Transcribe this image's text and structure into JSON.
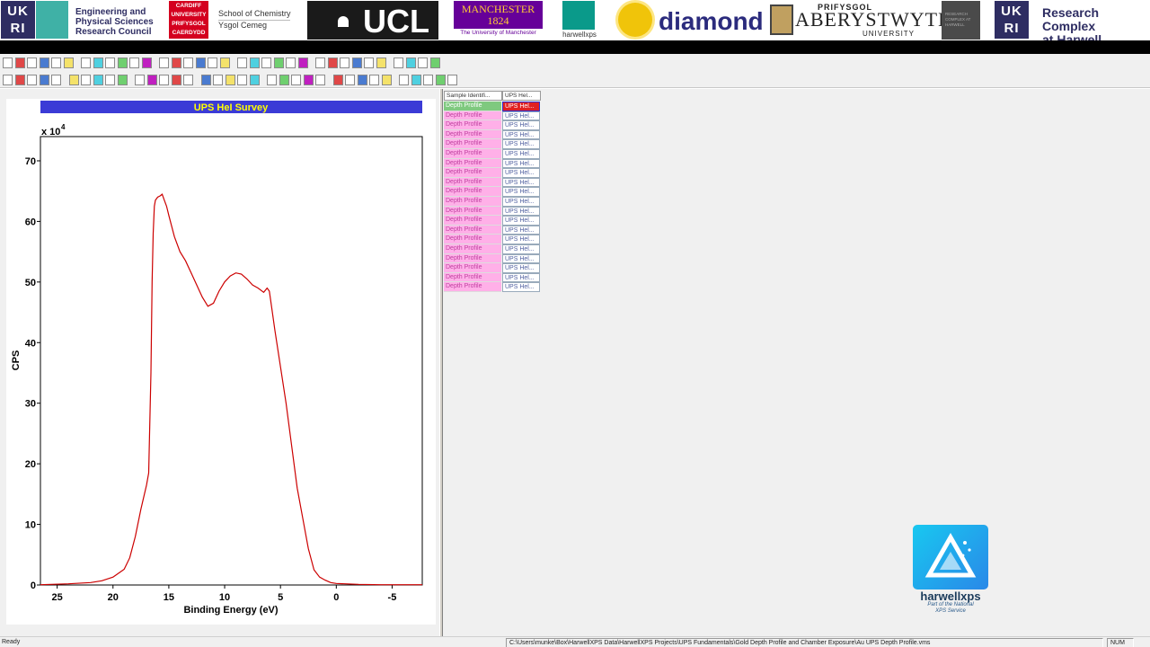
{
  "banner": {
    "ukri_text": "UK\nRI",
    "epsrc_text": "Engineering and\nPhysical Sciences\nResearch Council",
    "cardiff_logo_text": "CARDIFF\nUNIVERSITY\nPRIFYSGOL\nCAERDYDD",
    "cardiff_text": "School of Chemistry\nYsgol Cemeg",
    "ucl_text": "UCL",
    "manchester_text": "MANCHESTER\n1824",
    "manchester_sub": "The University of Manchester",
    "harwellxps_label": "harwellxps",
    "diamond_text": "diamond",
    "aber_top": "PRIFYSGOL",
    "aber_main": "ABERYSTWYTH",
    "aber_bottom": "UNIVERSITY",
    "rch_box_text": "RESEARCH COMPLEX AT HARWELL",
    "rch_text": "Research Complex\nat Harwell"
  },
  "chart_data": {
    "type": "line",
    "title": "UPS HeI Survey",
    "xlabel": "Binding Energy (eV)",
    "ylabel": "CPS",
    "y_multiplier_label": "x 10",
    "y_multiplier_exp": "4",
    "xlim": [
      26.5,
      -7.7
    ],
    "ylim": [
      0,
      74
    ],
    "x_ticks": [
      25,
      20,
      15,
      10,
      5,
      0,
      -5
    ],
    "y_ticks": [
      0,
      10,
      20,
      30,
      40,
      50,
      60,
      70
    ],
    "x_tick_labels": [
      "25",
      "20",
      "15",
      "10",
      "5",
      "0",
      "-5"
    ],
    "y_tick_labels": [
      "0",
      "10",
      "20",
      "30",
      "40",
      "50",
      "60",
      "70"
    ],
    "line_color": "#cc0000",
    "grid": false,
    "series": [
      {
        "points": [
          [
            26.5,
            0.05
          ],
          [
            24,
            0.2
          ],
          [
            22,
            0.4
          ],
          [
            21,
            0.7
          ],
          [
            20,
            1.3
          ],
          [
            19,
            2.6
          ],
          [
            18.5,
            4.5
          ],
          [
            18,
            8
          ],
          [
            17.5,
            12.5
          ],
          [
            17,
            16.5
          ],
          [
            16.8,
            18.5
          ],
          [
            16.6,
            35
          ],
          [
            16.5,
            50
          ],
          [
            16.4,
            58
          ],
          [
            16.3,
            62.5
          ],
          [
            16.2,
            63.5
          ],
          [
            16,
            64
          ],
          [
            15.8,
            64.2
          ],
          [
            15.6,
            64.5
          ],
          [
            15.4,
            63.5
          ],
          [
            15.2,
            62.5
          ],
          [
            15,
            61
          ],
          [
            14.5,
            57.5
          ],
          [
            14,
            55
          ],
          [
            13.5,
            53.5
          ],
          [
            13,
            51.5
          ],
          [
            12.5,
            49.5
          ],
          [
            12,
            47.5
          ],
          [
            11.5,
            46
          ],
          [
            11,
            46.5
          ],
          [
            10.5,
            48.5
          ],
          [
            10,
            50
          ],
          [
            9.5,
            51
          ],
          [
            9,
            51.5
          ],
          [
            8.5,
            51.3
          ],
          [
            8,
            50.5
          ],
          [
            7.5,
            49.5
          ],
          [
            7,
            49
          ],
          [
            6.5,
            48.3
          ],
          [
            6.2,
            49
          ],
          [
            6,
            48.5
          ],
          [
            5.8,
            46
          ],
          [
            5.5,
            42
          ],
          [
            5,
            36
          ],
          [
            4.5,
            30
          ],
          [
            4,
            23
          ],
          [
            3.5,
            16
          ],
          [
            3,
            11
          ],
          [
            2.5,
            6
          ],
          [
            2,
            2.5
          ],
          [
            1.5,
            1.3
          ],
          [
            1,
            0.8
          ],
          [
            0.5,
            0.4
          ],
          [
            0,
            0.25
          ],
          [
            -2,
            0.1
          ],
          [
            -4,
            0.05
          ],
          [
            -7.7,
            0.05
          ]
        ]
      }
    ]
  },
  "table": {
    "headers": [
      "Sample Identifi...",
      "UPS Hel..."
    ],
    "rows": [
      {
        "sample": "Depth Profile",
        "block": "UPS Hel..."
      },
      {
        "sample": "Depth Profile",
        "block": "UPS Hel..."
      },
      {
        "sample": "Depth Profile",
        "block": "UPS Hel..."
      },
      {
        "sample": "Depth Profile",
        "block": "UPS Hel..."
      },
      {
        "sample": "Depth Profile",
        "block": "UPS Hel..."
      },
      {
        "sample": "Depth Profile",
        "block": "UPS Hel..."
      },
      {
        "sample": "Depth Profile",
        "block": "UPS Hel..."
      },
      {
        "sample": "Depth Profile",
        "block": "UPS Hel..."
      },
      {
        "sample": "Depth Profile",
        "block": "UPS Hel..."
      },
      {
        "sample": "Depth Profile",
        "block": "UPS Hel..."
      },
      {
        "sample": "Depth Profile",
        "block": "UPS Hel..."
      },
      {
        "sample": "Depth Profile",
        "block": "UPS Hel..."
      },
      {
        "sample": "Depth Profile",
        "block": "UPS Hel..."
      },
      {
        "sample": "Depth Profile",
        "block": "UPS Hel..."
      },
      {
        "sample": "Depth Profile",
        "block": "UPS Hel..."
      },
      {
        "sample": "Depth Profile",
        "block": "UPS Hel..."
      },
      {
        "sample": "Depth Profile",
        "block": "UPS Hel..."
      },
      {
        "sample": "Depth Profile",
        "block": "UPS Hel..."
      },
      {
        "sample": "Depth Profile",
        "block": "UPS Hel..."
      },
      {
        "sample": "Depth Profile",
        "block": "UPS Hel..."
      }
    ],
    "selected_row": 0
  },
  "logo": {
    "name": "harwellxps",
    "tagline": "Part of the National\nXPS Service"
  },
  "statusbar": {
    "ready": "Ready",
    "path": "C:\\Users\\munke\\Box\\HarwellXPS Data\\HarwellXPS Projects\\UPS Fundamentals\\Gold Depth Profile and Chamber Exposure\\Au UPS Depth Profile.vms",
    "num": "NUM"
  },
  "toolbar": {
    "row1_buttons": [
      "new-icon",
      "open-icon",
      "save-icon",
      "save-all-icon",
      "print-setup-icon",
      "copy-icon",
      "paste-icon",
      "copy-block-icon",
      "paste-block-icon",
      "delete-icon",
      "annotate-icon",
      "report-icon",
      "table-icon",
      "options-icon",
      "calc-icon",
      "edit-icon",
      "display-icon",
      "zoom-icon",
      "shift-icon",
      "overlay-icon",
      "overlay-icon",
      "spectrum-icon",
      "spectrum-icon",
      "range-icon",
      "move-icon",
      "draw-icon",
      "browser-icon",
      "setup-icon",
      "processing-icon",
      "quantify-icon",
      "annotation-icon",
      "print-icon",
      "print-preview-icon",
      "help-icon"
    ],
    "row2_buttons": [
      "select-icon",
      "tile-icon",
      "colour-icon",
      "fill-icon",
      "grid-icon",
      "first-icon",
      "prev-icon",
      "next-icon",
      "last-icon",
      "zoom-in-icon",
      "zoom-out-icon",
      "pan-icon",
      "scale-icon",
      "expand-icon",
      "compress-icon",
      "reverse-icon",
      "stack-icon",
      "offset-icon",
      "normalise-icon",
      "smooth-icon",
      "differentiate-icon",
      "integrate-icon",
      "subtract-icon",
      "add-icon",
      "multiply-icon",
      "divide-icon",
      "peak-icon",
      "fit-icon",
      "calibrate-icon",
      "charge-icon",
      "label-icon",
      "reset-icon",
      "undo-icon",
      "redo-icon",
      "export-icon"
    ]
  }
}
